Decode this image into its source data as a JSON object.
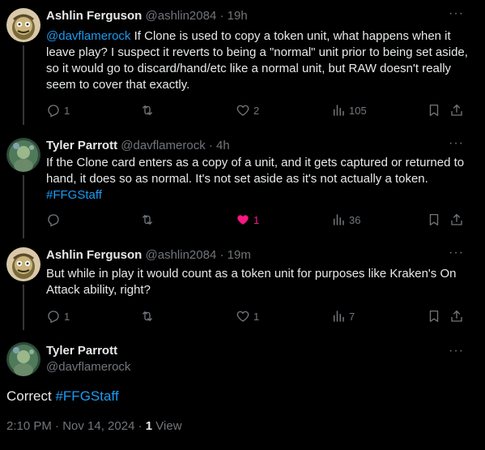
{
  "tweets": [
    {
      "name": "Ashlin Ferguson",
      "handle": "@ashlin2084",
      "time": "19h",
      "mention": "@davflamerock",
      "text": " If Clone is used to copy a token unit, what happens when it leave play? I suspect it reverts to being a \"normal\" unit prior to being set aside, so it would go to discard/hand/etc like a normal unit, but RAW doesn't really seem to cover that exactly.",
      "replies": "1",
      "retweets": "",
      "likes": "2",
      "views": "105"
    },
    {
      "name": "Tyler Parrott",
      "handle": "@davflamerock",
      "time": "4h",
      "text": "If the Clone card enters as a copy of a unit, and it gets captured or returned to hand, it does so as normal. It's not set aside as it's not actually a token.",
      "hashtag": "#FFGStaff",
      "replies": "",
      "retweets": "",
      "likes": "1",
      "views": "36"
    },
    {
      "name": "Ashlin Ferguson",
      "handle": "@ashlin2084",
      "time": "19m",
      "text": "But while in play it would count as a token unit for purposes like Kraken's On Attack ability, right?",
      "replies": "1",
      "retweets": "",
      "likes": "1",
      "views": "7"
    }
  ],
  "main_tweet": {
    "name": "Tyler Parrott",
    "handle": "@davflamerock",
    "text": "Correct ",
    "hashtag": "#FFGStaff",
    "timestamp": "2:10 PM · Nov 14, 2024",
    "separator": " · ",
    "views_count": "1",
    "views_label": " View"
  },
  "ui": {
    "separator_dot": "·",
    "more_label": "···"
  },
  "colors": {
    "background": "#000000",
    "text": "#e7e9ea",
    "muted": "#71767b",
    "link": "#1d9bf0",
    "like_active": "#f91880",
    "divider": "#2f3336"
  },
  "icons": [
    "reply-icon",
    "retweet-icon",
    "heart-icon",
    "views-icon",
    "bookmark-icon",
    "share-icon",
    "more-icon"
  ]
}
